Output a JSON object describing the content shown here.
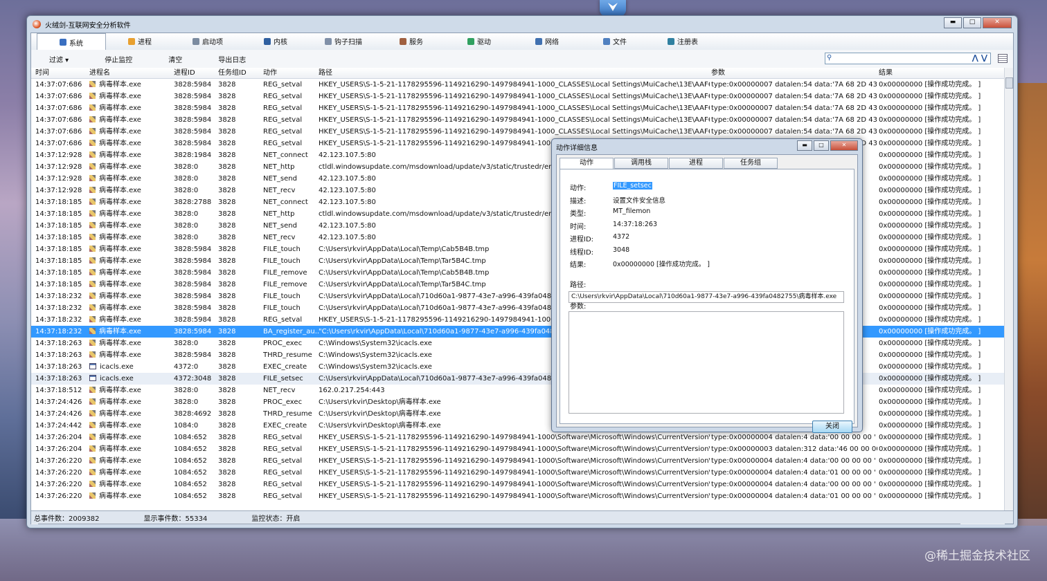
{
  "window": {
    "title": "火绒剑-互联网安全分析软件"
  },
  "tabs": [
    {
      "label": "系统",
      "icon": "system-icon",
      "color": "#3a6fc0"
    },
    {
      "label": "进程",
      "icon": "process-icon",
      "color": "#e8a030"
    },
    {
      "label": "启动项",
      "icon": "startup-icon",
      "color": "#7b8ba0"
    },
    {
      "label": "内核",
      "icon": "kernel-icon",
      "color": "#3060a0"
    },
    {
      "label": "钩子扫描",
      "icon": "hook-icon",
      "color": "#8090a8"
    },
    {
      "label": "服务",
      "icon": "service-icon",
      "color": "#a06040"
    },
    {
      "label": "驱动",
      "icon": "driver-icon",
      "color": "#30a060"
    },
    {
      "label": "网络",
      "icon": "network-icon",
      "color": "#4070b0"
    },
    {
      "label": "文件",
      "icon": "file-icon",
      "color": "#5080c0"
    },
    {
      "label": "注册表",
      "icon": "registry-icon",
      "color": "#3080a0"
    }
  ],
  "toolbar": {
    "filter": "过滤 ▾",
    "stop": "停止监控",
    "clear": "清空",
    "export": "导出日志",
    "search_value": ""
  },
  "columns": [
    "时间",
    "进程名",
    "进程ID",
    "任务组ID",
    "动作",
    "路径",
    "参数",
    "结果"
  ],
  "rows": [
    [
      "14:37:07:686",
      "病毒样本.exe",
      "3828:5984",
      "3828",
      "REG_setval",
      "HKEY_USERS\\S-1-5-21-1178295596-1149216290-1497984941-1000_CLASSES\\Local Settings\\MuiCache\\13E\\AAF68885\\...",
      "type:0x00000007 datalen:54 data:'7A 68 2D 43 4E...",
      "0x00000000 [操作成功完成。 ]"
    ],
    [
      "14:37:07:686",
      "病毒样本.exe",
      "3828:5984",
      "3828",
      "REG_setval",
      "HKEY_USERS\\S-1-5-21-1178295596-1149216290-1497984941-1000_CLASSES\\Local Settings\\MuiCache\\13E\\AAF68885\\...",
      "type:0x00000007 datalen:54 data:'7A 68 2D 43 4E...",
      "0x00000000 [操作成功完成。 ]"
    ],
    [
      "14:37:07:686",
      "病毒样本.exe",
      "3828:5984",
      "3828",
      "REG_setval",
      "HKEY_USERS\\S-1-5-21-1178295596-1149216290-1497984941-1000_CLASSES\\Local Settings\\MuiCache\\13E\\AAF68885\\...",
      "type:0x00000007 datalen:54 data:'7A 68 2D 43 4E...",
      "0x00000000 [操作成功完成。 ]"
    ],
    [
      "14:37:07:686",
      "病毒样本.exe",
      "3828:5984",
      "3828",
      "REG_setval",
      "HKEY_USERS\\S-1-5-21-1178295596-1149216290-1497984941-1000_CLASSES\\Local Settings\\MuiCache\\13E\\AAF68885\\...",
      "type:0x00000007 datalen:54 data:'7A 68 2D 43 4E...",
      "0x00000000 [操作成功完成。 ]"
    ],
    [
      "14:37:07:686",
      "病毒样本.exe",
      "3828:5984",
      "3828",
      "REG_setval",
      "HKEY_USERS\\S-1-5-21-1178295596-1149216290-1497984941-1000_CLASSES\\Local Settings\\MuiCache\\13E\\AAF68885\\...",
      "type:0x00000007 datalen:54 data:'7A 68 2D 43 4E...",
      "0x00000000 [操作成功完成。 ]"
    ],
    [
      "14:37:07:686",
      "病毒样本.exe",
      "3828:5984",
      "3828",
      "REG_setval",
      "HKEY_USERS\\S-1-5-21-1178295596-1149216290-1497984941-1000_CLASSES\\Local Settings\\MuiCache\\13E\\AAF68885\\...",
      "type:0x00000007 datalen:54 data:'7A 68 2D 43 4E...",
      "0x00000000 [操作成功完成。 ]"
    ],
    [
      "14:37:12:928",
      "病毒样本.exe",
      "3828:1984",
      "3828",
      "NET_connect",
      "42.123.107.5:80",
      "",
      "0x00000000 [操作成功完成。 ]"
    ],
    [
      "14:37:12:928",
      "病毒样本.exe",
      "3828:0",
      "3828",
      "NET_http",
      "ctldl.windowsupdate.com/msdownload/update/v3/static/trustedr/en/disallowedcertstl.cab",
      "",
      "0x00000000 [操作成功完成。 ]"
    ],
    [
      "14:37:12:928",
      "病毒样本.exe",
      "3828:0",
      "3828",
      "NET_send",
      "42.123.107.5:80",
      "",
      "0x00000000 [操作成功完成。 ]"
    ],
    [
      "14:37:12:928",
      "病毒样本.exe",
      "3828:0",
      "3828",
      "NET_recv",
      "42.123.107.5:80",
      "",
      "0x00000000 [操作成功完成。 ]"
    ],
    [
      "14:37:18:185",
      "病毒样本.exe",
      "3828:2788",
      "3828",
      "NET_connect",
      "42.123.107.5:80",
      "",
      "0x00000000 [操作成功完成。 ]"
    ],
    [
      "14:37:18:185",
      "病毒样本.exe",
      "3828:0",
      "3828",
      "NET_http",
      "ctldl.windowsupdate.com/msdownload/update/v3/static/trustedr/en/authrootstl.cab",
      "",
      "0x00000000 [操作成功完成。 ]"
    ],
    [
      "14:37:18:185",
      "病毒样本.exe",
      "3828:0",
      "3828",
      "NET_send",
      "42.123.107.5:80",
      "",
      "0x00000000 [操作成功完成。 ]"
    ],
    [
      "14:37:18:185",
      "病毒样本.exe",
      "3828:0",
      "3828",
      "NET_recv",
      "42.123.107.5:80",
      "",
      "0x00000000 [操作成功完成。 ]"
    ],
    [
      "14:37:18:185",
      "病毒样本.exe",
      "3828:5984",
      "3828",
      "FILE_touch",
      "C:\\Users\\rkvir\\AppData\\Local\\Temp\\Cab5B4B.tmp",
      "",
      "0x00000000 [操作成功完成。 ]"
    ],
    [
      "14:37:18:185",
      "病毒样本.exe",
      "3828:5984",
      "3828",
      "FILE_touch",
      "C:\\Users\\rkvir\\AppData\\Local\\Temp\\Tar5B4C.tmp",
      "",
      "0x00000000 [操作成功完成。 ]"
    ],
    [
      "14:37:18:185",
      "病毒样本.exe",
      "3828:5984",
      "3828",
      "FILE_remove",
      "C:\\Users\\rkvir\\AppData\\Local\\Temp\\Cab5B4B.tmp",
      "",
      "0x00000000 [操作成功完成。 ]"
    ],
    [
      "14:37:18:185",
      "病毒样本.exe",
      "3828:5984",
      "3828",
      "FILE_remove",
      "C:\\Users\\rkvir\\AppData\\Local\\Temp\\Tar5B4C.tmp",
      "",
      "0x00000000 [操作成功完成。 ]"
    ],
    [
      "14:37:18:232",
      "病毒样本.exe",
      "3828:5984",
      "3828",
      "FILE_touch",
      "C:\\Users\\rkvir\\AppData\\Local\\710d60a1-9877-43e7-a996-439fa0482755",
      "",
      "0x00000000 [操作成功完成。 ]"
    ],
    [
      "14:37:18:232",
      "病毒样本.exe",
      "3828:5984",
      "3828",
      "FILE_touch",
      "C:\\Users\\rkvir\\AppData\\Local\\710d60a1-9877-43e7-a996-439fa0482755",
      "",
      "0x00000000 [操作成功完成。 ]"
    ],
    [
      "14:37:18:232",
      "病毒样本.exe",
      "3828:5984",
      "3828",
      "REG_setval",
      "HKEY_USERS\\S-1-5-21-1178295596-1149216290-1497984941-1000\\Software",
      "",
      "0x00000000 [操作成功完成。 ]"
    ],
    [
      "14:37:18:232",
      "病毒样本.exe",
      "3828:5984",
      "3828",
      "BA_register_au...",
      "\"C:\\Users\\rkvir\\AppData\\Local\\710d60a1-9877-43e7-a996-439fa0482755",
      "",
      "0x00000000 [操作成功完成。 ]"
    ],
    [
      "14:37:18:263",
      "病毒样本.exe",
      "3828:0",
      "3828",
      "PROC_exec",
      "C:\\Windows\\System32\\icacls.exe",
      "",
      "0x00000000 [操作成功完成。 ]"
    ],
    [
      "14:37:18:263",
      "病毒样本.exe",
      "3828:5984",
      "3828",
      "THRD_resume",
      "C:\\Windows\\System32\\icacls.exe",
      "",
      "0x00000000 [操作成功完成。 ]"
    ],
    [
      "14:37:18:263",
      "icacls.exe",
      "4372:0",
      "3828",
      "EXEC_create",
      "C:\\Windows\\System32\\icacls.exe",
      "",
      "0x00000000 [操作成功完成。 ]"
    ],
    [
      "14:37:18:263",
      "icacls.exe",
      "4372:3048",
      "3828",
      "FILE_setsec",
      "C:\\Users\\rkvir\\AppData\\Local\\710d60a1-9877-43e7-a996-439fa0482755",
      "",
      "0x00000000 [操作成功完成。 ]"
    ],
    [
      "14:37:18:512",
      "病毒样本.exe",
      "3828:0",
      "3828",
      "NET_recv",
      "162.0.217.254:443",
      "",
      "0x00000000 [操作成功完成。 ]"
    ],
    [
      "14:37:24:426",
      "病毒样本.exe",
      "3828:0",
      "3828",
      "PROC_exec",
      "C:\\Users\\rkvir\\Desktop\\病毒样本.exe",
      "",
      "0x00000000 [操作成功完成。 ]"
    ],
    [
      "14:37:24:426",
      "病毒样本.exe",
      "3828:4692",
      "3828",
      "THRD_resume",
      "C:\\Users\\rkvir\\Desktop\\病毒样本.exe",
      "",
      "0x00000000 [操作成功完成。 ]"
    ],
    [
      "14:37:24:442",
      "病毒样本.exe",
      "1084:0",
      "3828",
      "EXEC_create",
      "C:\\Users\\rkvir\\Desktop\\病毒样本.exe",
      "",
      "0x00000000 [操作成功完成。 ]"
    ],
    [
      "14:37:26:204",
      "病毒样本.exe",
      "1084:652",
      "3828",
      "REG_setval",
      "HKEY_USERS\\S-1-5-21-1178295596-1149216290-1497984941-1000\\Software\\Microsoft\\Windows\\CurrentVersion\\Inter...",
      "type:0x00000004 datalen:4 data:'00 00 00 00 '",
      "0x00000000 [操作成功完成。 ]"
    ],
    [
      "14:37:26:204",
      "病毒样本.exe",
      "1084:652",
      "3828",
      "REG_setval",
      "HKEY_USERS\\S-1-5-21-1178295596-1149216290-1497984941-1000\\Software\\Microsoft\\Windows\\CurrentVersion\\Inter...",
      "type:0x00000003 datalen:312 data:'46 00 00 00 7...",
      "0x00000000 [操作成功完成。 ]"
    ],
    [
      "14:37:26:220",
      "病毒样本.exe",
      "1084:652",
      "3828",
      "REG_setval",
      "HKEY_USERS\\S-1-5-21-1178295596-1149216290-1497984941-1000\\Software\\Microsoft\\Windows\\CurrentVersion\\Inter...",
      "type:0x00000004 datalen:4 data:'00 00 00 00 '",
      "0x00000000 [操作成功完成。 ]"
    ],
    [
      "14:37:26:220",
      "病毒样本.exe",
      "1084:652",
      "3828",
      "REG_setval",
      "HKEY_USERS\\S-1-5-21-1178295596-1149216290-1497984941-1000\\Software\\Microsoft\\Windows\\CurrentVersion\\Inter...",
      "type:0x00000004 datalen:4 data:'01 00 00 00 '",
      "0x00000000 [操作成功完成。 ]"
    ],
    [
      "14:37:26:220",
      "病毒样本.exe",
      "1084:652",
      "3828",
      "REG_setval",
      "HKEY_USERS\\S-1-5-21-1178295596-1149216290-1497984941-1000\\Software\\Microsoft\\Windows\\CurrentVersion\\Inter...",
      "type:0x00000004 datalen:4 data:'00 00 00 00 '",
      "0x00000000 [操作成功完成。 ]"
    ],
    [
      "14:37:26:220",
      "病毒样本.exe",
      "1084:652",
      "3828",
      "REG_setval",
      "HKEY_USERS\\S-1-5-21-1178295596-1149216290-1497984941-1000\\Software\\Microsoft\\Windows\\CurrentVersion\\Inter...",
      "type:0x00000004 datalen:4 data:'01 00 00 00 '",
      "0x00000000 [操作成功完成。 ]"
    ]
  ],
  "selected_row": 21,
  "hover_row": 25,
  "status": {
    "total": "总事件数：2009382",
    "shown": "显示事件数：55334",
    "monitor": "监控状态：开启"
  },
  "dialog": {
    "title": "动作详细信息",
    "tabs": [
      "动作",
      "调用栈",
      "进程",
      "任务组"
    ],
    "fields": [
      {
        "label": "动作:",
        "value": "FILE_setsec"
      },
      {
        "label": "描述:",
        "value": "设置文件安全信息"
      },
      {
        "label": "类型:",
        "value": "MT_filemon"
      },
      {
        "label": "时间:",
        "value": "14:37:18:263"
      },
      {
        "label": "进程ID:",
        "value": "4372"
      },
      {
        "label": "线程ID:",
        "value": "3048"
      },
      {
        "label": "结果:",
        "value": "0x00000000 [操作成功完成。 ]"
      }
    ],
    "path_label": "路径:",
    "path": "C:\\Users\\rkvir\\AppData\\Local\\710d60a1-9877-43e7-a996-439fa0482755\\病毒样本.exe",
    "param_label": "参数:",
    "close": "关闭"
  },
  "watermark": "@稀土掘金技术社区"
}
